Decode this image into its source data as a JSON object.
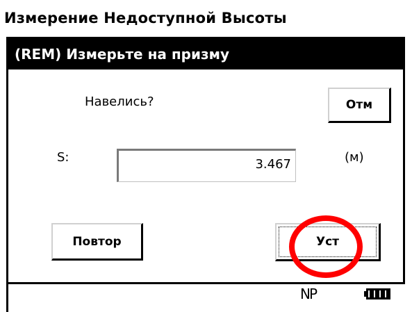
{
  "app": {
    "title": "Измерение Недоступной Высоты"
  },
  "dialog": {
    "title": "(REM) Измерьте на призму",
    "prompt": "Навелись?",
    "cancel_label": "Отм",
    "field_label": "S:",
    "distance_value": "3.467",
    "unit": "(м)",
    "retry_label": "Повтор",
    "set_label": "Уст"
  },
  "status_bar": {
    "mode": "NP",
    "battery_icon": "battery-full-icon"
  },
  "colors": {
    "header_bg": "#000000",
    "highlight": "#ff0000"
  }
}
